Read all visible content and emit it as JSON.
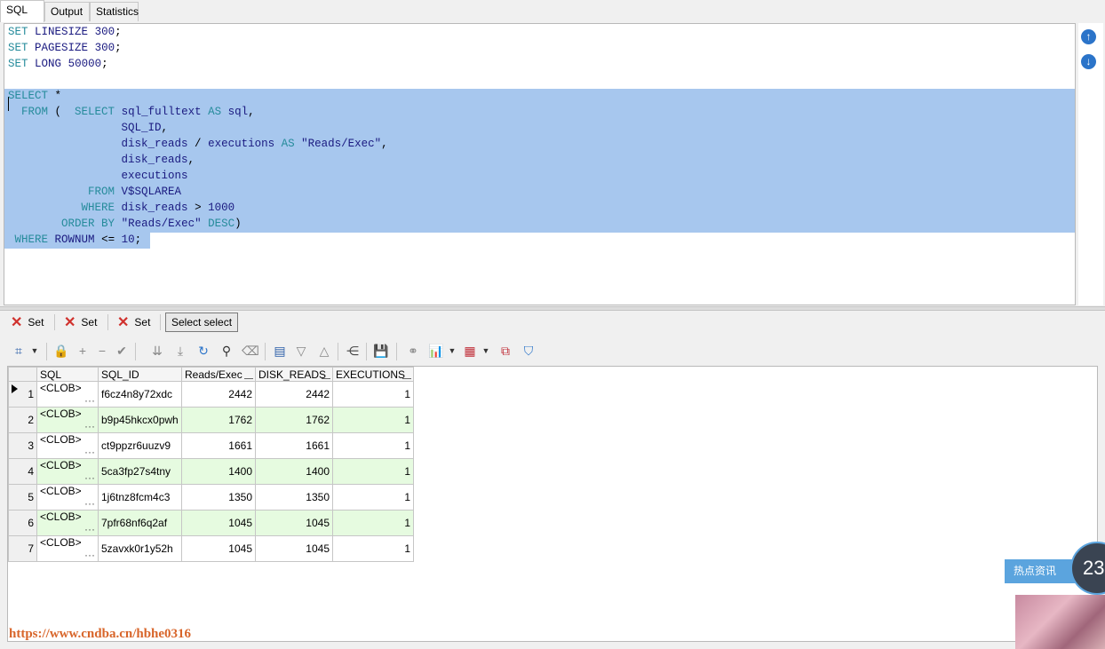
{
  "top_tabs": [
    "SQL",
    "Output",
    "Statistics"
  ],
  "editor": {
    "lines": [
      "SET LINESIZE 300;",
      "SET PAGESIZE 300;",
      "SET LONG 50000;",
      "",
      "SELECT *",
      "  FROM (  SELECT sql_fulltext AS sql,",
      "                 SQL_ID,",
      "                 disk_reads / executions AS \"Reads/Exec\",",
      "                 disk_reads,",
      "                 executions",
      "            FROM V$SQLAREA",
      "           WHERE disk_reads > 1000",
      "        ORDER BY \"Reads/Exec\" DESC)",
      " WHERE ROWNUM <= 10;"
    ]
  },
  "result_tabs": [
    "Set",
    "Set",
    "Set",
    "Select select"
  ],
  "grid": {
    "columns": [
      "SQL",
      "SQL_ID",
      "Reads/Exec",
      "DISK_READS",
      "EXECUTIONS"
    ],
    "rows": [
      {
        "n": "1",
        "sql": "<CLOB>",
        "ellipsis": "···",
        "sql_id": "f6cz4n8y72xdc",
        "reads_exec": "2442",
        "disk_reads": "2442",
        "executions": "1"
      },
      {
        "n": "2",
        "sql": "<CLOB>",
        "ellipsis": "···",
        "sql_id": "b9p45hkcx0pwh",
        "reads_exec": "1762",
        "disk_reads": "1762",
        "executions": "1"
      },
      {
        "n": "3",
        "sql": "<CLOB>",
        "ellipsis": "···",
        "sql_id": "ct9ppzr6uuzv9",
        "reads_exec": "1661",
        "disk_reads": "1661",
        "executions": "1"
      },
      {
        "n": "4",
        "sql": "<CLOB>",
        "ellipsis": "···",
        "sql_id": "5ca3fp27s4tny",
        "reads_exec": "1400",
        "disk_reads": "1400",
        "executions": "1"
      },
      {
        "n": "5",
        "sql": "<CLOB>",
        "ellipsis": "···",
        "sql_id": "1j6tnz8fcm4c3",
        "reads_exec": "1350",
        "disk_reads": "1350",
        "executions": "1"
      },
      {
        "n": "6",
        "sql": "<CLOB>",
        "ellipsis": "···",
        "sql_id": "7pfr68nf6q2af",
        "reads_exec": "1045",
        "disk_reads": "1045",
        "executions": "1"
      },
      {
        "n": "7",
        "sql": "<CLOB>",
        "ellipsis": "···",
        "sql_id": "5zavxk0r1y52h",
        "reads_exec": "1045",
        "disk_reads": "1045",
        "executions": "1"
      }
    ]
  },
  "watermark": "https://www.cndba.cn/hbhe0316",
  "ad": {
    "header": "热点资讯",
    "badge": "23"
  },
  "colors": {
    "keyword": "#258b9b",
    "selection": "#a7c7ee",
    "alt_row": "#e6fbe0",
    "close_x": "#d0312d",
    "accent": "#2b74c9"
  }
}
